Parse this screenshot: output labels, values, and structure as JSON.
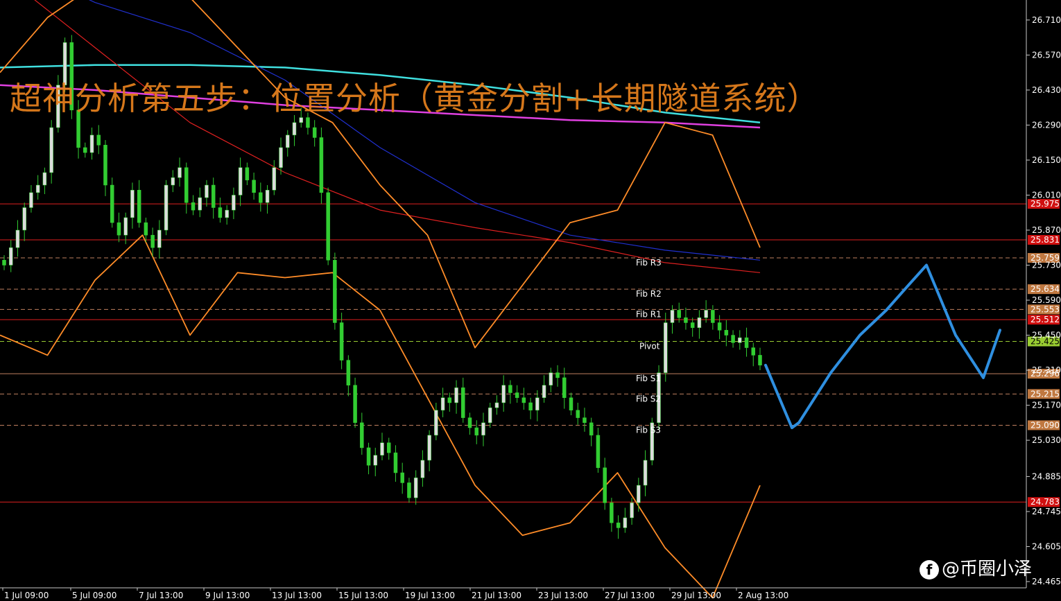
{
  "chart_data": {
    "type": "candlestick",
    "title": "超神分析第五步：位置分析（黄金分割+长期隧道系统）",
    "xlabel": "",
    "ylabel": "",
    "y_ticks": [
      26.71,
      26.57,
      26.43,
      26.29,
      26.15,
      26.01,
      25.87,
      25.73,
      25.59,
      25.45,
      25.31,
      25.17,
      25.03,
      24.885,
      24.745,
      24.605,
      24.465
    ],
    "ylim": [
      24.44,
      26.79
    ],
    "x_tick_labels": [
      "1 Jul 09:00",
      "5 Jul 09:00",
      "7 Jul 13:00",
      "9 Jul 13:00",
      "13 Jul 13:00",
      "15 Jul 13:00",
      "19 Jul 13:00",
      "21 Jul 13:00",
      "23 Jul 13:00",
      "27 Jul 13:00",
      "29 Jul 13:00",
      "2 Aug 13:00"
    ],
    "candle_colors": {
      "up": "#dcdcdc",
      "down": "#32cd32"
    },
    "horizontal_levels": [
      {
        "value": 25.975,
        "label": "25.975",
        "style": "solid",
        "color": "#e02020"
      },
      {
        "value": 25.831,
        "label": "25.831",
        "style": "solid",
        "color": "#e02020"
      },
      {
        "value": 25.759,
        "label": "25.759",
        "style": "dashed",
        "color": "#c08060"
      },
      {
        "value": 25.634,
        "label": "25.634",
        "style": "dashed",
        "color": "#c08060"
      },
      {
        "value": 25.553,
        "label": "25.553",
        "style": "dashed",
        "color": "#c08060"
      },
      {
        "value": 25.512,
        "label": "25.512",
        "style": "solid",
        "color": "#e02020"
      },
      {
        "value": 25.425,
        "label": "25.425",
        "style": "dashed",
        "color": "#9acd32"
      },
      {
        "value": 25.296,
        "label": "25.296",
        "style": "solid",
        "color": "#c08060"
      },
      {
        "value": 25.215,
        "label": "25.215",
        "style": "dashed",
        "color": "#c08060"
      },
      {
        "value": 25.09,
        "label": "25.090",
        "style": "dashed",
        "color": "#c08060"
      },
      {
        "value": 24.783,
        "label": "24.783",
        "style": "solid",
        "color": "#e02020"
      }
    ],
    "fib_labels": [
      {
        "label": "Fib R3",
        "value": 25.759
      },
      {
        "label": "Fib R2",
        "value": 25.634
      },
      {
        "label": "Fib R1",
        "value": 25.553
      },
      {
        "label": "Pivot",
        "value": 25.425
      },
      {
        "label": "Fib S1",
        "value": 25.296
      },
      {
        "label": "Fib S2",
        "value": 25.215
      },
      {
        "label": "Fib S3",
        "value": 25.09
      }
    ],
    "series": [
      {
        "type": "close",
        "values": [
          25.73,
          25.8,
          25.87,
          25.96,
          26.02,
          26.05,
          26.1,
          26.28,
          26.45,
          26.62,
          26.35,
          26.2,
          26.18,
          26.25,
          26.21,
          26.05,
          25.9,
          25.85,
          25.92,
          26.03,
          25.9,
          25.85,
          25.8,
          25.87,
          26.05,
          26.08,
          26.12,
          25.98,
          25.95,
          26.0,
          26.05,
          25.96,
          25.92,
          25.95,
          26.01,
          26.12,
          26.07,
          26.02,
          25.98,
          26.03,
          26.12,
          26.2,
          26.25,
          26.3,
          26.32,
          26.28,
          26.24,
          26.02,
          25.75,
          25.5,
          25.35,
          25.25,
          25.1,
          25.0,
          24.93,
          24.97,
          25.02,
          24.98,
          24.9,
          24.86,
          24.8,
          24.88,
          24.95,
          25.05,
          25.15,
          25.2,
          25.18,
          25.24,
          25.12,
          25.08,
          25.05,
          25.1,
          25.16,
          25.18,
          25.25,
          25.22,
          25.2,
          25.18,
          25.15,
          25.2,
          25.25,
          25.3,
          25.28,
          25.2,
          25.15,
          25.12,
          25.1,
          25.05,
          24.92,
          24.78,
          24.7,
          24.68,
          24.72,
          24.78,
          24.85,
          24.95,
          25.1,
          25.3,
          25.5,
          25.55,
          25.52,
          25.5,
          25.48,
          25.52,
          25.55,
          25.5,
          25.47,
          25.45,
          25.42,
          25.44,
          25.4,
          25.37,
          25.33
        ]
      },
      {
        "type": "projection",
        "color": "#2f8fe0",
        "values": [
          25.33,
          25.08,
          25.1,
          25.3,
          25.45,
          25.55,
          25.65,
          25.73,
          25.45,
          25.28,
          25.47
        ]
      },
      {
        "type": "moving_average",
        "color": "#40e0e0",
        "values": [
          26.52,
          26.53,
          26.53,
          26.52,
          26.49,
          26.45,
          26.4,
          26.34,
          26.3
        ]
      },
      {
        "type": "moving_average",
        "color": "#e040e0",
        "values": [
          26.45,
          26.43,
          26.4,
          26.37,
          26.35,
          26.33,
          26.31,
          26.3,
          26.28
        ]
      },
      {
        "type": "moving_average",
        "color": "#2030d0",
        "values": [
          26.96,
          26.78,
          26.66,
          26.47,
          26.2,
          25.98,
          25.85,
          25.79,
          25.75
        ]
      },
      {
        "type": "moving_average",
        "color": "#e02020",
        "values": [
          26.9,
          26.6,
          26.3,
          26.1,
          25.95,
          25.88,
          25.82,
          25.74,
          25.7
        ]
      },
      {
        "type": "bollinger_upper",
        "color": "#ff8c28",
        "values": [
          26.5,
          26.72,
          26.85,
          26.95,
          26.8,
          26.6,
          26.4,
          26.3,
          26.05,
          25.85,
          25.4,
          25.65,
          25.9,
          25.95,
          26.3,
          26.25,
          25.8
        ]
      },
      {
        "type": "bollinger_lower",
        "color": "#ff8c28",
        "values": [
          25.45,
          25.37,
          25.67,
          25.85,
          25.45,
          25.7,
          25.68,
          25.7,
          25.55,
          25.2,
          24.85,
          24.65,
          24.7,
          24.9,
          24.6,
          24.4,
          24.85
        ]
      }
    ]
  },
  "watermark": {
    "logo": "f",
    "text": "@币圈小泽"
  }
}
